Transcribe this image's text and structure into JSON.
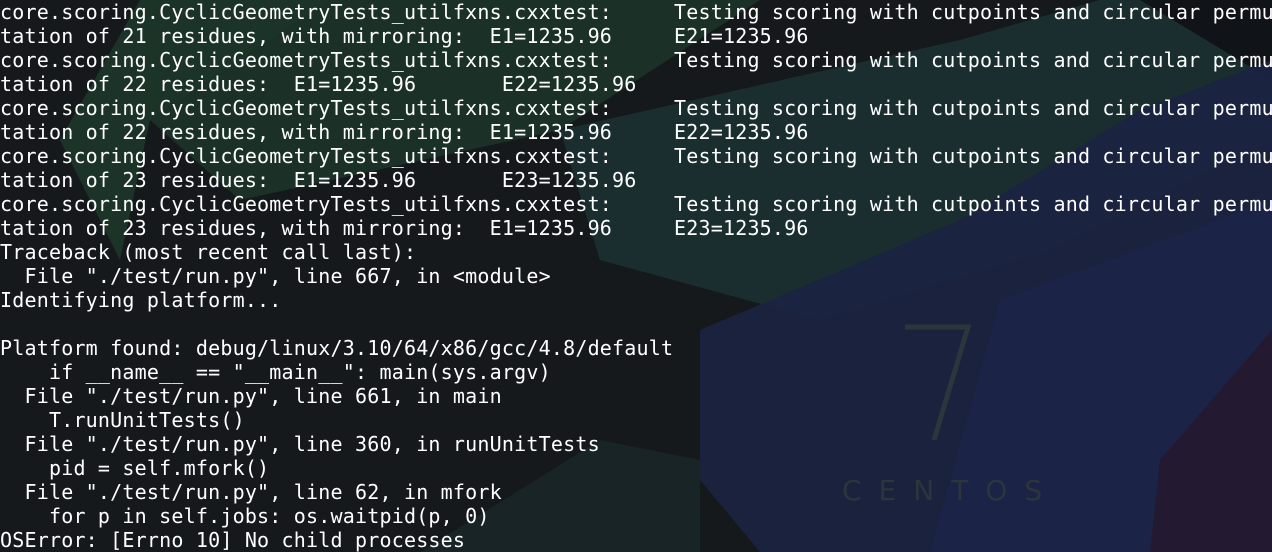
{
  "wallpaper": {
    "logo_numeral": "7",
    "logo_text": "CENTOS",
    "colors": {
      "base": "#15191c",
      "green": "#1b3328",
      "navy": "#1a2340",
      "purple": "#241a32",
      "cyan": "#1a3436"
    }
  },
  "terminal": {
    "lines": [
      {
        "c1": "core.scoring.CyclicGeometryTests_utilfxns.cxxtest:",
        "c2": "Testing scoring with cutpoints and circular permu"
      },
      {
        "c1": "tation of 21 residues, with mirroring:  E1=1235.96",
        "c2": "E21=1235.96"
      },
      {
        "c1": "core.scoring.CyclicGeometryTests_utilfxns.cxxtest:",
        "c2": "Testing scoring with cutpoints and circular permu"
      },
      {
        "c1": "tation of 22 residues:  E1=1235.96       E22=1235.96",
        "c2": ""
      },
      {
        "c1": "core.scoring.CyclicGeometryTests_utilfxns.cxxtest:",
        "c2": "Testing scoring with cutpoints and circular permu"
      },
      {
        "c1": "tation of 22 residues, with mirroring:  E1=1235.96",
        "c2": "E22=1235.96"
      },
      {
        "c1": "core.scoring.CyclicGeometryTests_utilfxns.cxxtest:",
        "c2": "Testing scoring with cutpoints and circular permu"
      },
      {
        "c1": "tation of 23 residues:  E1=1235.96       E23=1235.96",
        "c2": ""
      },
      {
        "c1": "core.scoring.CyclicGeometryTests_utilfxns.cxxtest:",
        "c2": "Testing scoring with cutpoints and circular permu"
      },
      {
        "c1": "tation of 23 residues, with mirroring:  E1=1235.96",
        "c2": "E23=1235.96"
      },
      {
        "c1": "Traceback (most recent call last):",
        "c2": ""
      },
      {
        "c1": "  File \"./test/run.py\", line 667, in <module>",
        "c2": ""
      },
      {
        "c1": "Identifying platform...",
        "c2": ""
      },
      {
        "c1": "",
        "c2": ""
      },
      {
        "c1": "Platform found: debug/linux/3.10/64/x86/gcc/4.8/default",
        "c2": ""
      },
      {
        "c1": "    if __name__ == \"__main__\": main(sys.argv)",
        "c2": ""
      },
      {
        "c1": "  File \"./test/run.py\", line 661, in main",
        "c2": ""
      },
      {
        "c1": "    T.runUnitTests()",
        "c2": ""
      },
      {
        "c1": "  File \"./test/run.py\", line 360, in runUnitTests",
        "c2": ""
      },
      {
        "c1": "    pid = self.mfork()",
        "c2": ""
      },
      {
        "c1": "  File \"./test/run.py\", line 62, in mfork",
        "c2": ""
      },
      {
        "c1": "    for p in self.jobs: os.waitpid(p, 0)",
        "c2": ""
      },
      {
        "c1": "OSError: [Errno 10] No child processes",
        "c2": ""
      }
    ]
  }
}
